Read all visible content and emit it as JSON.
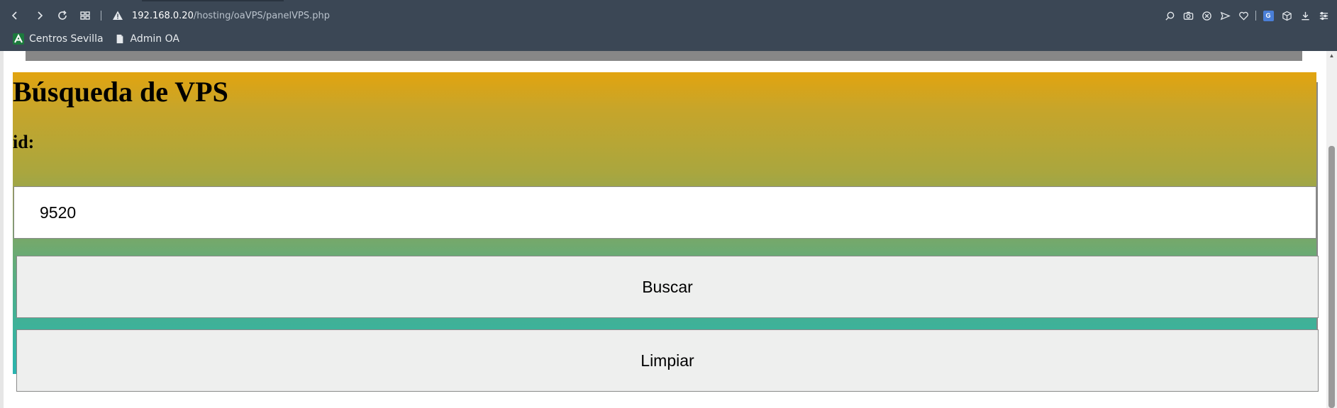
{
  "browser": {
    "url_host": "192.168.0.20",
    "url_path": "/hosting/oaVPS/panelVPS.php",
    "bookmarks": [
      {
        "label": "Centros Sevilla",
        "icon": "andalucia-logo-icon"
      },
      {
        "label": "Admin OA",
        "icon": "page-icon"
      }
    ],
    "nav_icons": [
      "back-icon",
      "forward-icon",
      "reload-icon",
      "tabs-grid-icon"
    ],
    "toolbar_icons": [
      "zoom-icon",
      "camera-icon",
      "adblock-icon",
      "send-icon",
      "heart-icon",
      "translate-icon",
      "cube-icon",
      "download-icon",
      "menu-icon"
    ]
  },
  "page": {
    "title": "Búsqueda de VPS",
    "id_label": "id:",
    "id_value": "9520",
    "search_button": "Buscar",
    "clear_button": "Limpiar"
  },
  "colors": {
    "chrome_bg": "#3b4755",
    "gradient_top": "#e2a40f",
    "gradient_bottom": "#2ab3b0",
    "shadow": "#878787"
  }
}
